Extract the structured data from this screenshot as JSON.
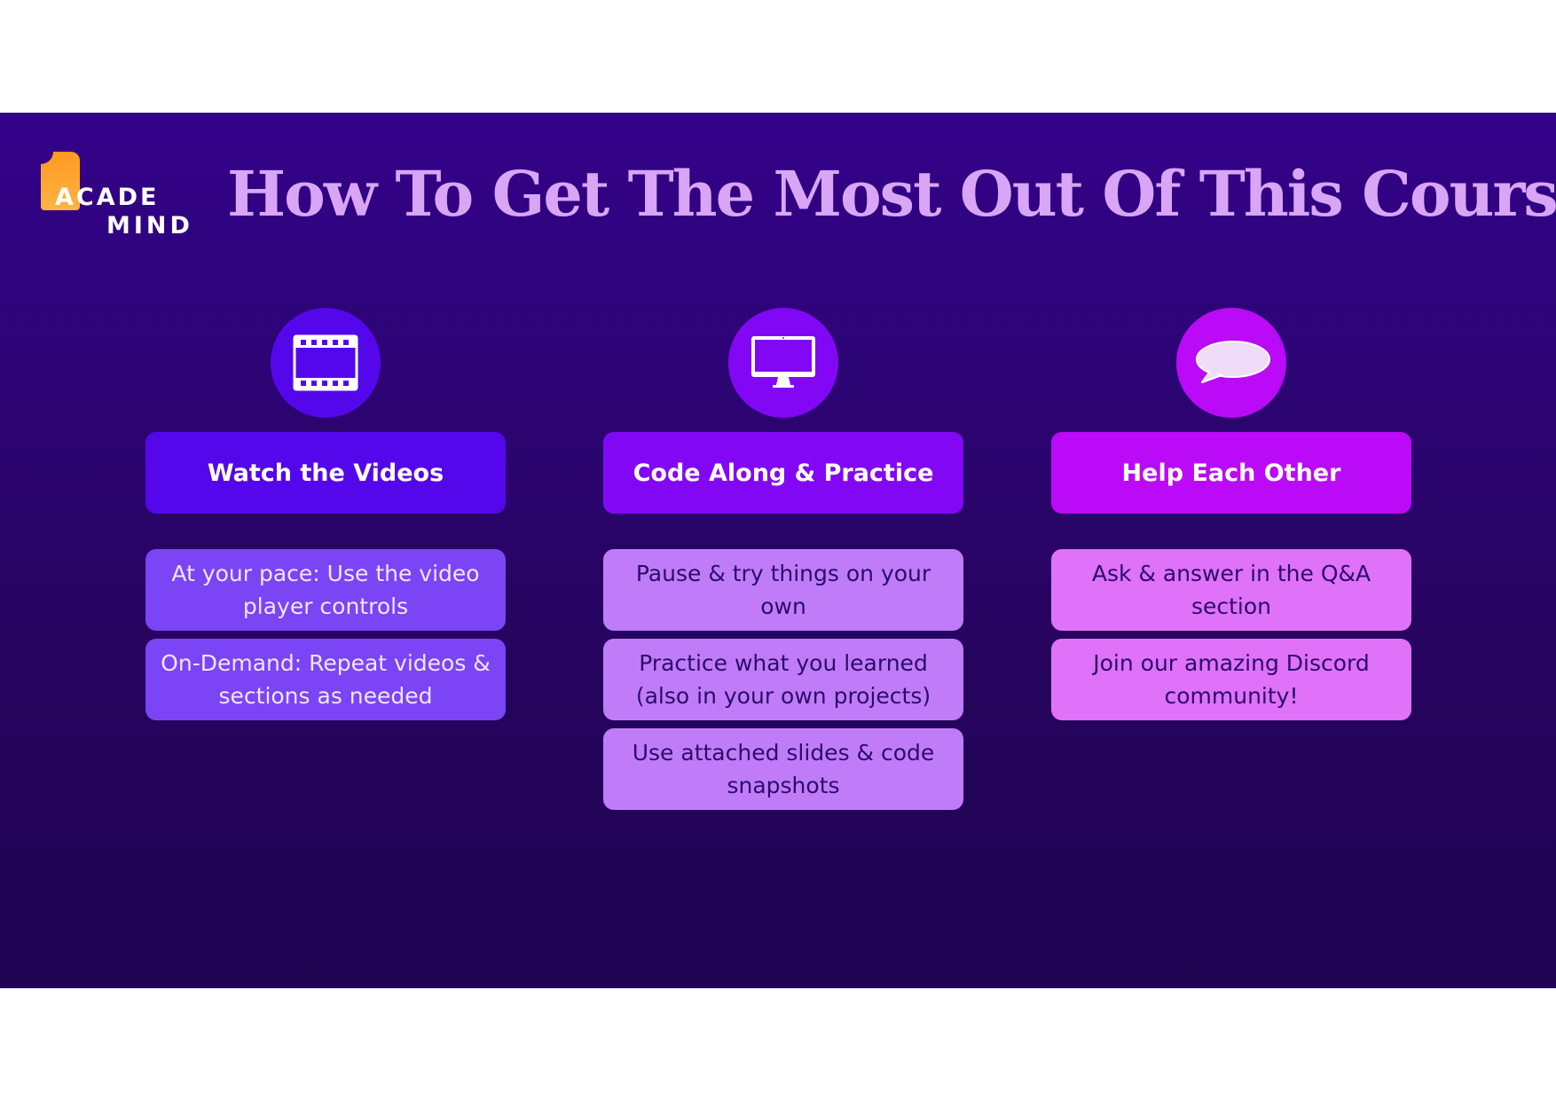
{
  "slide": {
    "title": "How To Get The Most Out Of This Course",
    "logo": {
      "line1": "ACADE",
      "line2": "MIND"
    },
    "columns": [
      {
        "icon": "film-icon",
        "heading": "Watch the Videos",
        "items": [
          "At your pace: Use the video player controls",
          "On-Demand: Repeat videos & sections as needed"
        ]
      },
      {
        "icon": "monitor-icon",
        "heading": "Code Along & Practice",
        "items": [
          "Pause & try things on your own",
          "Practice what you learned (also in your own projects)",
          "Use attached slides & code snapshots"
        ]
      },
      {
        "icon": "speech-bubble-icon",
        "heading": "Help Each Other",
        "items": [
          "Ask & answer in the Q&A section",
          "Join our amazing Discord community!"
        ]
      }
    ]
  },
  "colors": {
    "background": "#2a0570",
    "title": "#d9a6f7",
    "column1": "#5507ec",
    "column2": "#8208f5",
    "column3": "#bb0af8",
    "logo_accent": "#ffa52f"
  }
}
